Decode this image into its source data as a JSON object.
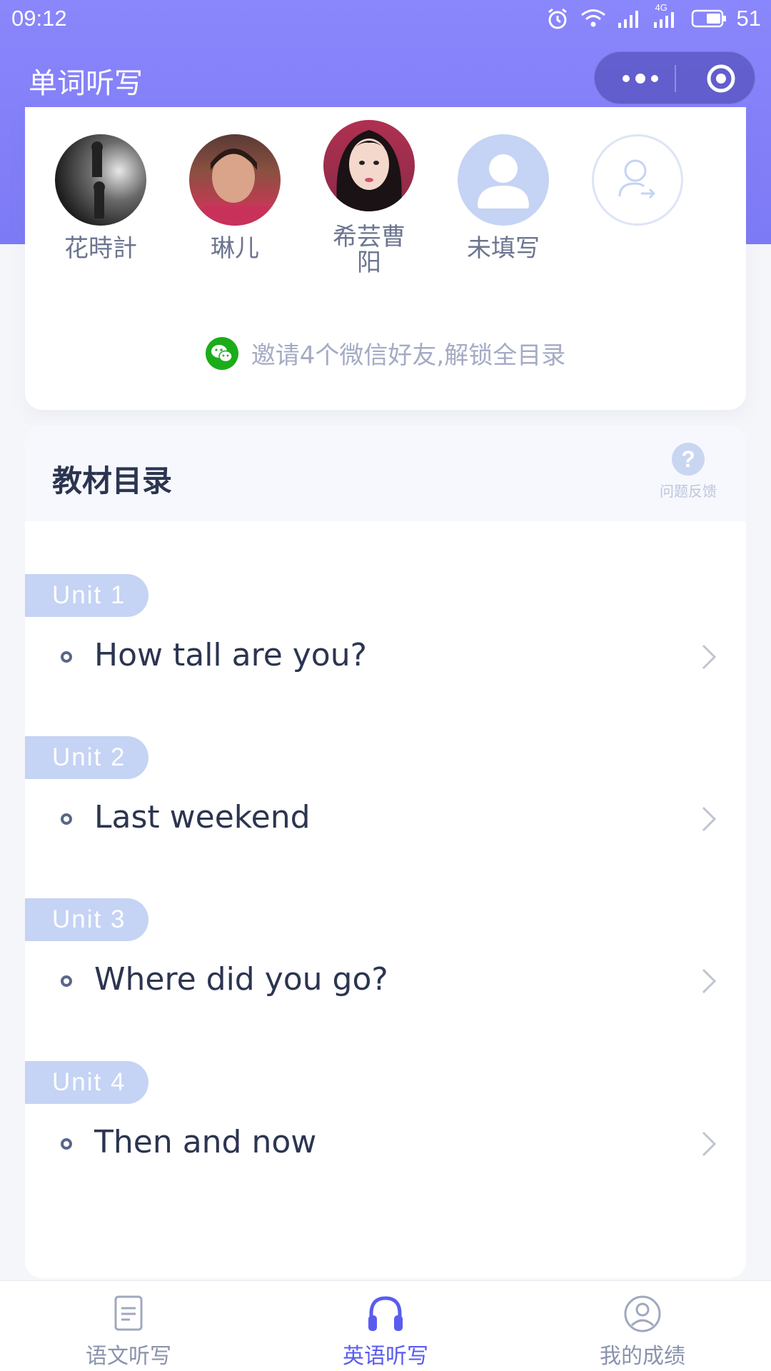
{
  "status_bar": {
    "time": "09:12",
    "network": "4G",
    "battery": "51"
  },
  "nav": {
    "title": "单词听写",
    "more_icon": "more-dots-icon",
    "close_icon": "target-close-icon"
  },
  "friends": {
    "items": [
      {
        "name": "花時計",
        "avatar": "photo"
      },
      {
        "name": "琳儿",
        "avatar": "photo"
      },
      {
        "name": "希芸曹阳",
        "avatar": "photo"
      },
      {
        "name": "未填写",
        "avatar": "default-person-icon"
      }
    ],
    "invite_slot_icon": "add-friend-icon",
    "invite_text": "邀请4个微信好友,解锁全目录"
  },
  "catalog": {
    "title": "教材目录",
    "feedback_label": "问题反馈",
    "feedback_icon": "?",
    "units": [
      {
        "tag": "Unit 1",
        "lesson": "How tall are you?"
      },
      {
        "tag": "Unit 2",
        "lesson": "Last weekend"
      },
      {
        "tag": "Unit 3",
        "lesson": "Where did you go?"
      },
      {
        "tag": "Unit 4",
        "lesson": "Then and now"
      }
    ]
  },
  "tabs": [
    {
      "label": "语文听写",
      "icon": "document-icon",
      "active": false
    },
    {
      "label": "英语听写",
      "icon": "headphones-icon",
      "active": true
    },
    {
      "label": "我的成绩",
      "icon": "user-circle-icon",
      "active": false
    }
  ],
  "colors": {
    "header": "#8a86fb",
    "accent": "#5a5cf0",
    "unit_tag": "#c5d3f4",
    "wechat_green": "#1aad19"
  }
}
